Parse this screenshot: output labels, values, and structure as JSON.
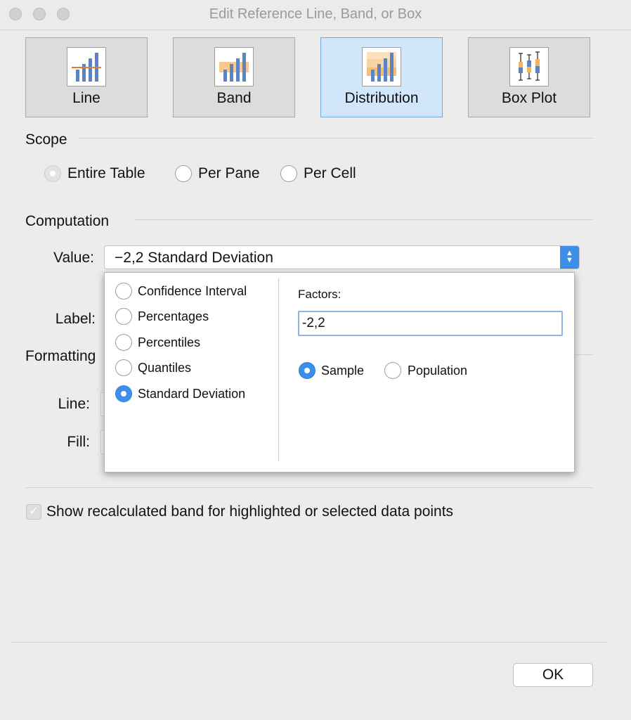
{
  "window": {
    "title": "Edit Reference Line, Band, or Box"
  },
  "types": [
    {
      "label": "Line",
      "icon": "reference-line-icon",
      "selected": false
    },
    {
      "label": "Band",
      "icon": "reference-band-icon",
      "selected": false
    },
    {
      "label": "Distribution",
      "icon": "distribution-icon",
      "selected": true
    },
    {
      "label": "Box Plot",
      "icon": "box-plot-icon",
      "selected": false
    }
  ],
  "scope": {
    "heading": "Scope",
    "options": [
      "Entire Table",
      "Per Pane",
      "Per Cell"
    ],
    "selected": "Entire Table"
  },
  "computation": {
    "heading": "Computation",
    "value_label": "Value:",
    "value": "−2,2 Standard Deviation",
    "label_label": "Label:"
  },
  "popup": {
    "options": [
      "Confidence Interval",
      "Percentages",
      "Percentiles",
      "Quantiles",
      "Standard Deviation"
    ],
    "selected": "Standard Deviation",
    "factors_label": "Factors:",
    "factors_value": "-2,2",
    "sample_label": "Sample",
    "population_label": "Population",
    "sample_selected": "Sample"
  },
  "formatting": {
    "heading": "Formatting",
    "line_label": "Line:",
    "fill_label": "Fill:"
  },
  "recalc": {
    "label": "Show recalculated band for highlighted or selected data points",
    "checked": true
  },
  "ok_label": "OK",
  "colors": {
    "accent": "#3d8ee8",
    "selected_tab": "#d2e6fb",
    "band_orange": "#f7c98f",
    "bar_blue": "#5b84c4"
  }
}
